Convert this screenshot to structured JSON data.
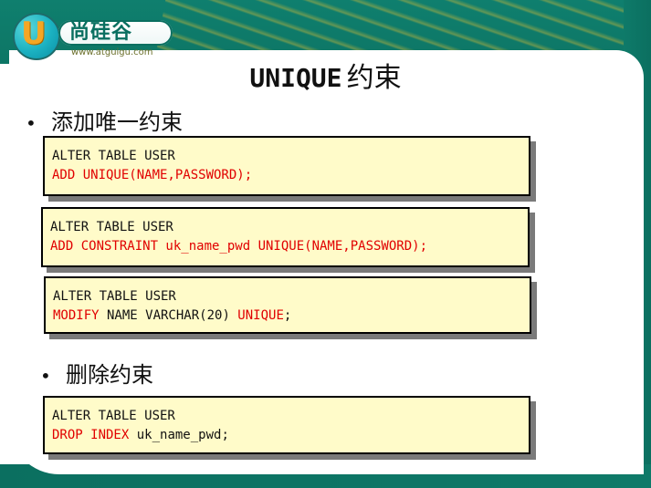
{
  "logo": {
    "letter": "U",
    "text": "尚硅谷",
    "url": "www.atguigu.com"
  },
  "title": {
    "code": "UNIQUE",
    "text": "约束"
  },
  "bullets": {
    "add": "添加唯一约束",
    "remove": "删除约束"
  },
  "code_blocks": [
    {
      "lines": [
        {
          "parts": [
            {
              "text": "ALTER TABLE USER",
              "color": "black"
            }
          ]
        },
        {
          "parts": [
            {
              "text": "ADD UNIQUE(NAME,PASSWORD);",
              "color": "red"
            }
          ]
        }
      ]
    },
    {
      "lines": [
        {
          "parts": [
            {
              "text": "ALTER TABLE USER",
              "color": "black"
            }
          ]
        },
        {
          "parts": [
            {
              "text": "ADD CONSTRAINT uk_name_pwd UNIQUE(NAME,PASSWORD);",
              "color": "red"
            }
          ]
        }
      ]
    },
    {
      "lines": [
        {
          "parts": [
            {
              "text": "ALTER TABLE USER",
              "color": "black"
            }
          ]
        },
        {
          "parts": [
            {
              "text": "MODIFY",
              "color": "red"
            },
            {
              "text": " NAME VARCHAR(20) ",
              "color": "black"
            },
            {
              "text": "UNIQUE",
              "color": "red"
            },
            {
              "text": ";",
              "color": "black"
            }
          ]
        }
      ]
    },
    {
      "lines": [
        {
          "parts": [
            {
              "text": "ALTER TABLE USER",
              "color": "black"
            }
          ]
        },
        {
          "parts": [
            {
              "text": "DROP INDEX",
              "color": "red"
            },
            {
              "text": " uk_name_pwd;",
              "color": "black"
            }
          ]
        }
      ]
    }
  ],
  "colors": {
    "teal": "#0f7f6e",
    "code_bg": "#fffbc9",
    "keyword_red": "#e10000"
  }
}
